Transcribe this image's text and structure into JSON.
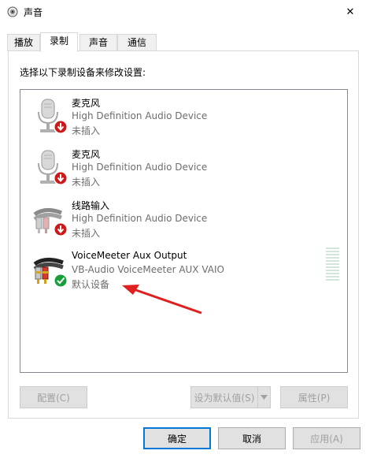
{
  "window": {
    "title": "声音",
    "close_glyph": "✕"
  },
  "tabs": [
    {
      "label": "播放",
      "active": false
    },
    {
      "label": "录制",
      "active": true
    },
    {
      "label": "声音",
      "active": false
    },
    {
      "label": "通信",
      "active": false
    }
  ],
  "panel": {
    "instruction": "选择以下录制设备来修改设置:"
  },
  "devices": [
    {
      "name": "麦克风",
      "description": "High Definition Audio Device",
      "status": "未插入",
      "icon": "microphone-icon",
      "badge": "unplugged-badge-icon"
    },
    {
      "name": "麦克风",
      "description": "High Definition Audio Device",
      "status": "未插入",
      "icon": "microphone-icon",
      "badge": "unplugged-badge-icon"
    },
    {
      "name": "线路输入",
      "description": "High Definition Audio Device",
      "status": "未插入",
      "icon": "line-in-cable-icon",
      "badge": "unplugged-badge-icon"
    },
    {
      "name": "VoiceMeeter Aux Output",
      "description": "VB-Audio VoiceMeeter AUX VAIO",
      "status": "默认设备",
      "icon": "line-in-cable-icon",
      "badge": "default-check-badge-icon"
    }
  ],
  "buttons": {
    "configure": "配置(C)",
    "set_default": "设为默认值(S)",
    "properties": "属性(P)",
    "ok": "确定",
    "cancel": "取消",
    "apply": "应用(A)"
  },
  "colors": {
    "unplugged_badge": "#cc1a1a",
    "default_badge": "#1a9e3c",
    "annotation_arrow": "#e02020",
    "focus_border": "#0078d7"
  }
}
